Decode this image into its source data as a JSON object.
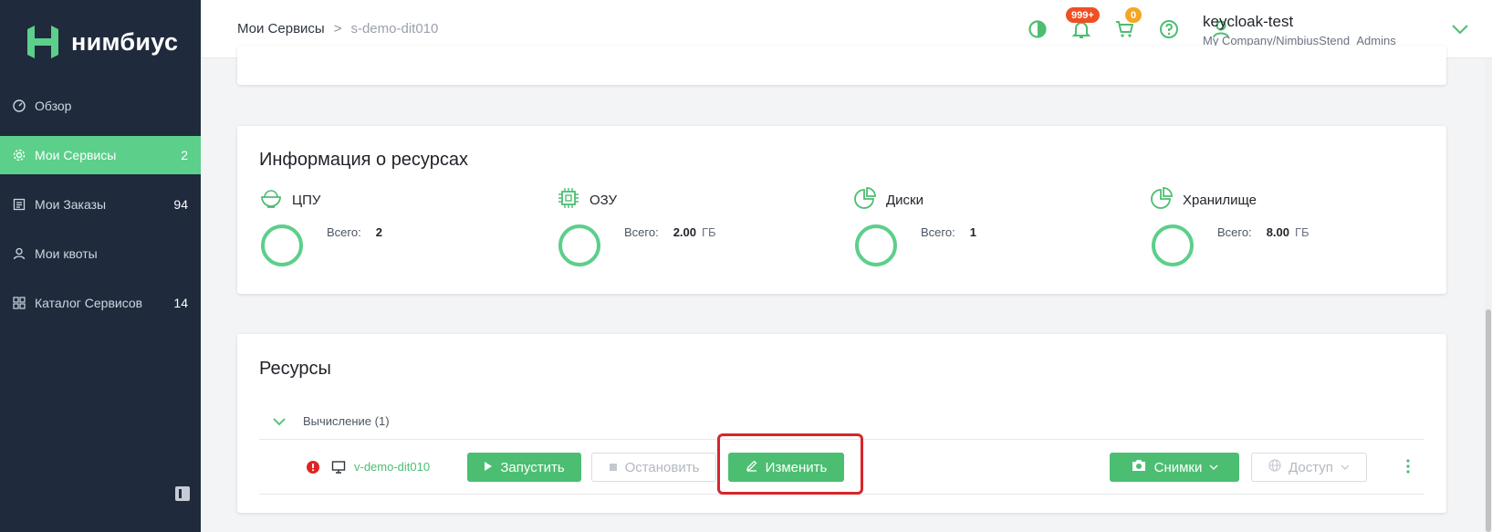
{
  "app": {
    "logo_text": "нимбиус",
    "brand_color": "#5ccf8b"
  },
  "sidebar": {
    "items": [
      {
        "label": "Обзор",
        "count": "",
        "icon": "dashboard-icon"
      },
      {
        "label": "Мои Сервисы",
        "count": "2",
        "icon": "gear-icon",
        "active": true
      },
      {
        "label": "Мои Заказы",
        "count": "94",
        "icon": "list-icon"
      },
      {
        "label": "Мои квоты",
        "count": "",
        "icon": "user-icon"
      },
      {
        "label": "Каталог Сервисов",
        "count": "14",
        "icon": "grid-icon"
      }
    ]
  },
  "header": {
    "breadcrumb": {
      "root": "Мои Сервисы",
      "separator": ">",
      "current": "s-demo-dit010"
    },
    "notifications_badge": "999+",
    "cart_badge": "0",
    "user": {
      "name": "keycloak-test",
      "org": "My Company/NimbiusStend_Admins"
    }
  },
  "resources_info": {
    "title": "Информация о ресурсах",
    "total_label": "Всего:",
    "items": [
      {
        "name": "ЦПУ",
        "icon": "cpu-bowl-icon",
        "total": "2",
        "unit": ""
      },
      {
        "name": "ОЗУ",
        "icon": "chip-icon",
        "total": "2.00",
        "unit": "ГБ"
      },
      {
        "name": "Диски",
        "icon": "pie-chart-icon",
        "total": "1",
        "unit": ""
      },
      {
        "name": "Хранилище",
        "icon": "pie-chart-icon",
        "total": "8.00",
        "unit": "ГБ"
      }
    ]
  },
  "resources": {
    "title": "Ресурсы",
    "group_label": "Вычисление (1)",
    "vm": {
      "name": "v-demo-dit010",
      "start_label": "Запустить",
      "stop_label": "Остановить",
      "edit_label": "Изменить",
      "snapshots_label": "Снимки",
      "access_label": "Доступ"
    }
  }
}
